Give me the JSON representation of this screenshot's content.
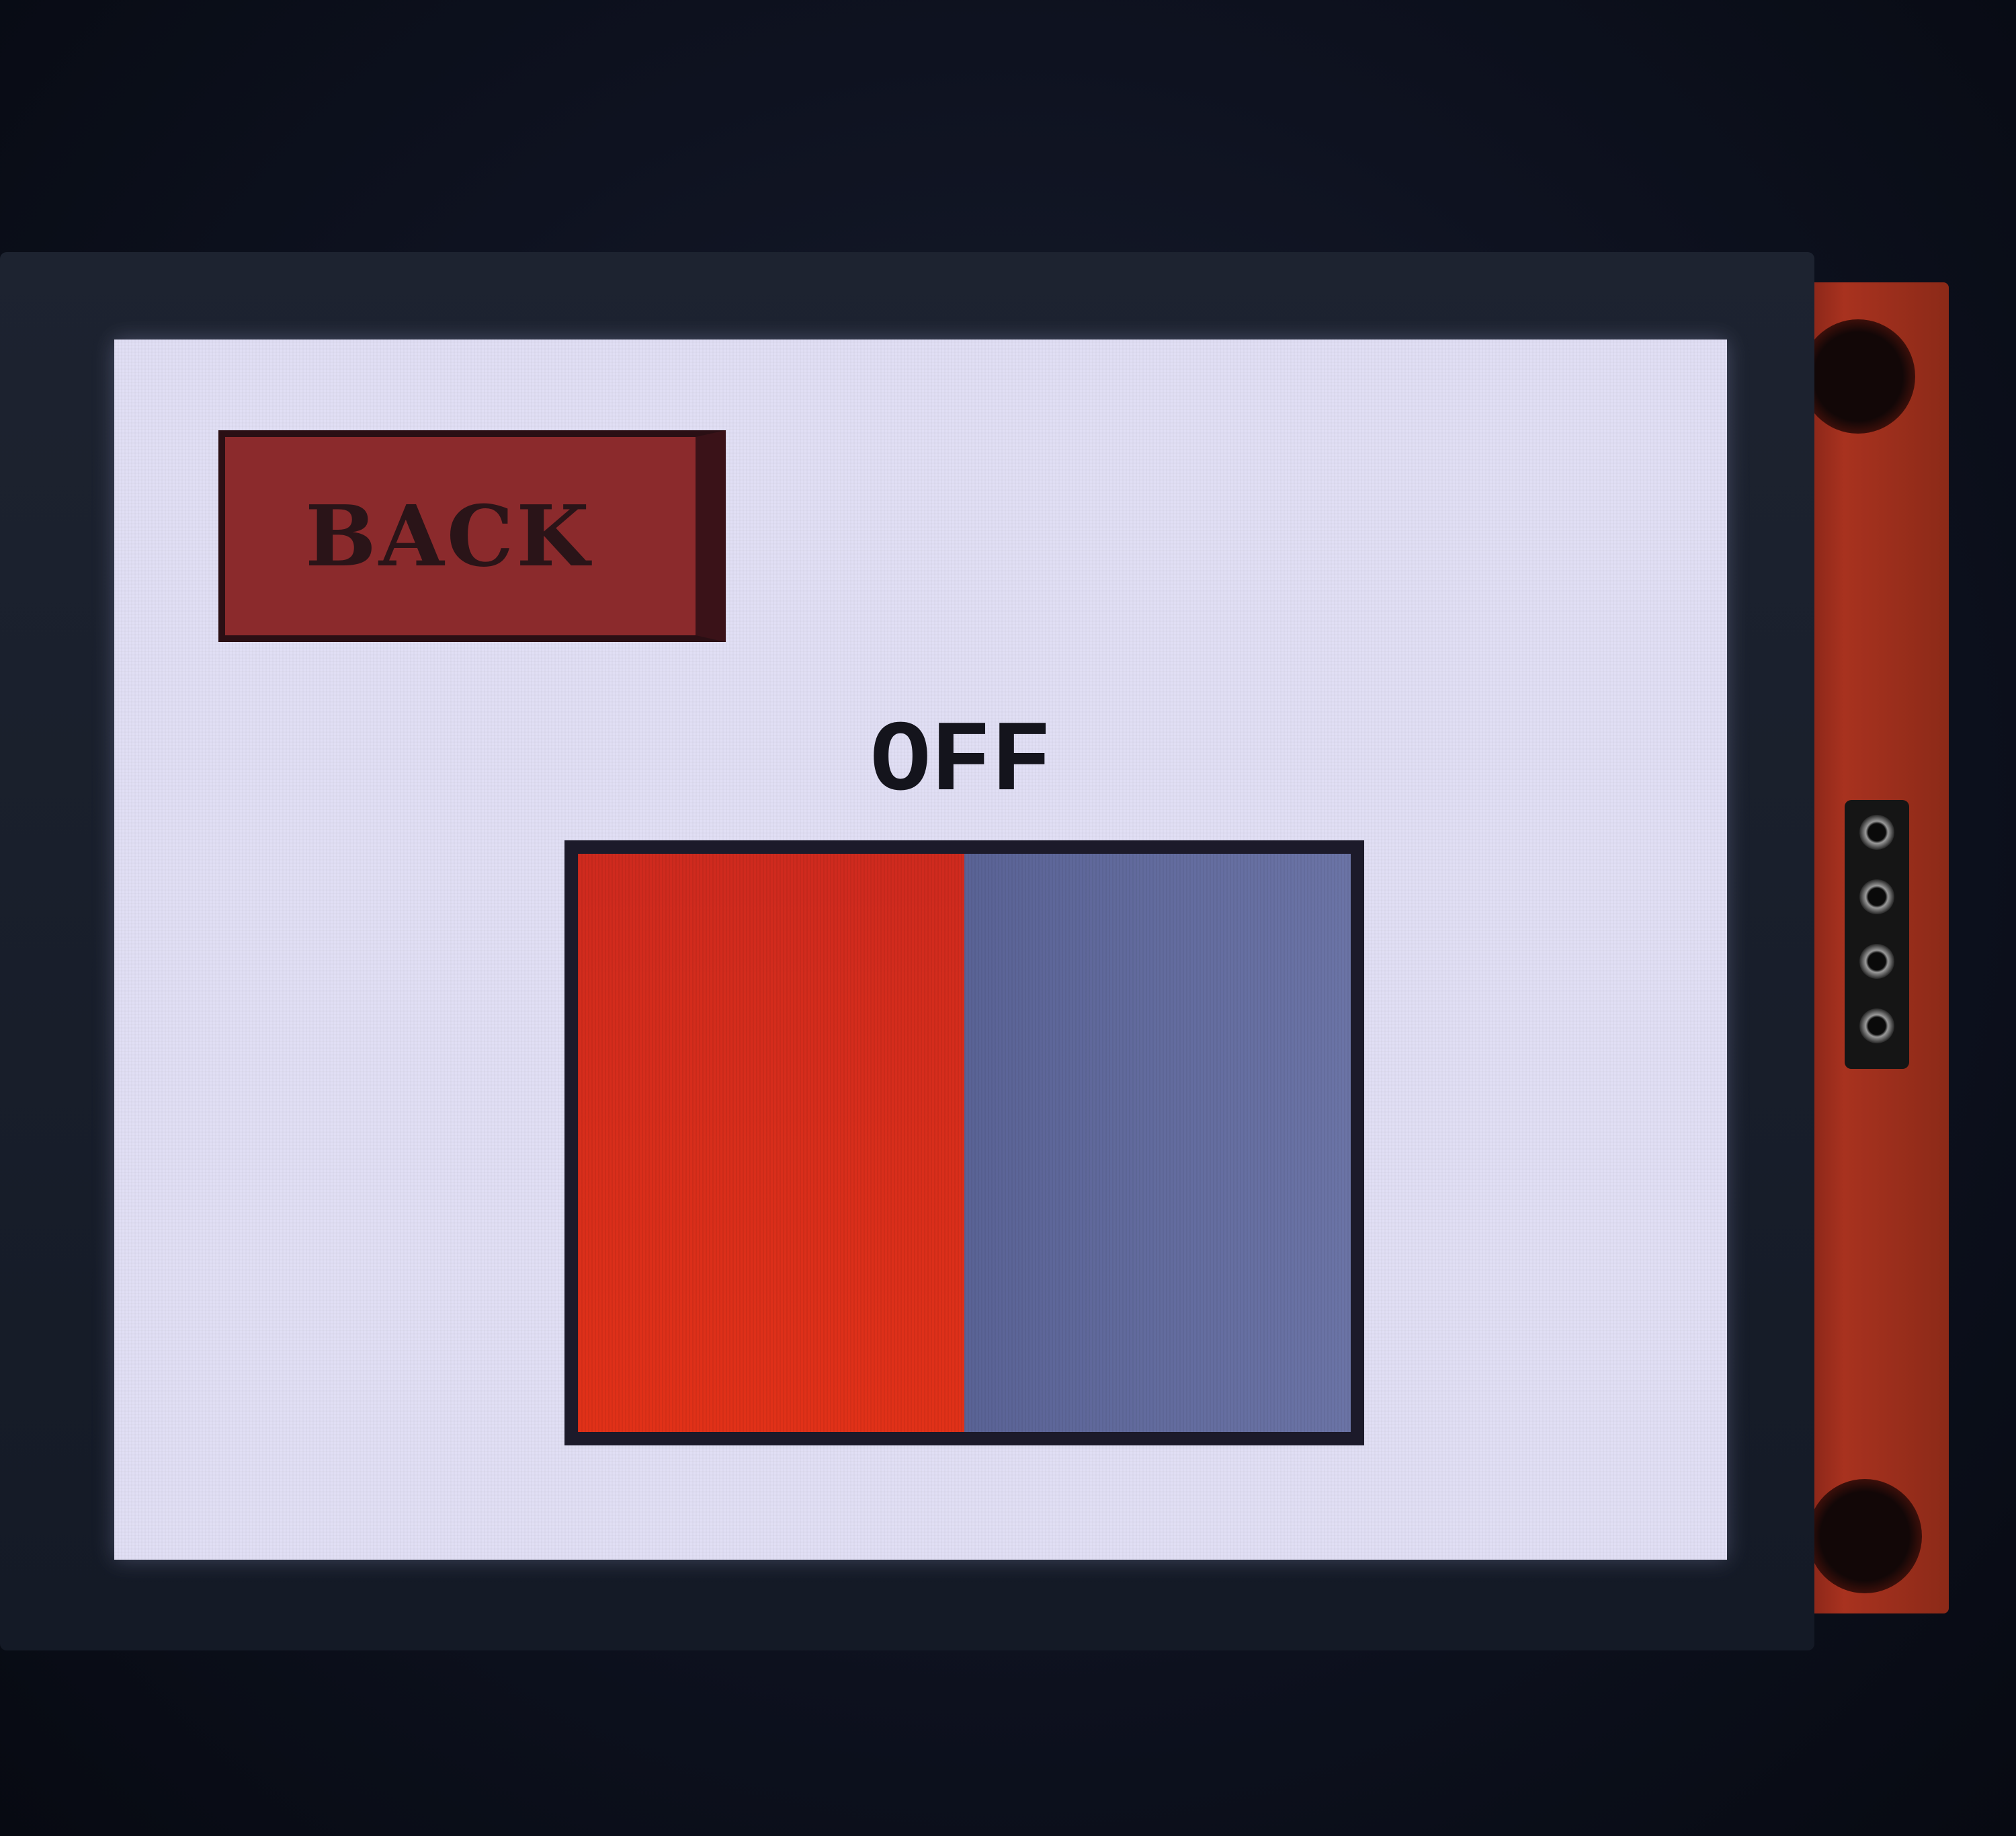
{
  "screen": {
    "back_button": {
      "label": "BACK"
    },
    "status": {
      "text": "OFF"
    },
    "toggle": {
      "state": "off",
      "left_color": "#d82d1b",
      "right_color": "#636c9e"
    }
  },
  "colors": {
    "screen_background": "#e1dff5",
    "button_fill": "#8b2a2c",
    "text": "#14141c"
  }
}
